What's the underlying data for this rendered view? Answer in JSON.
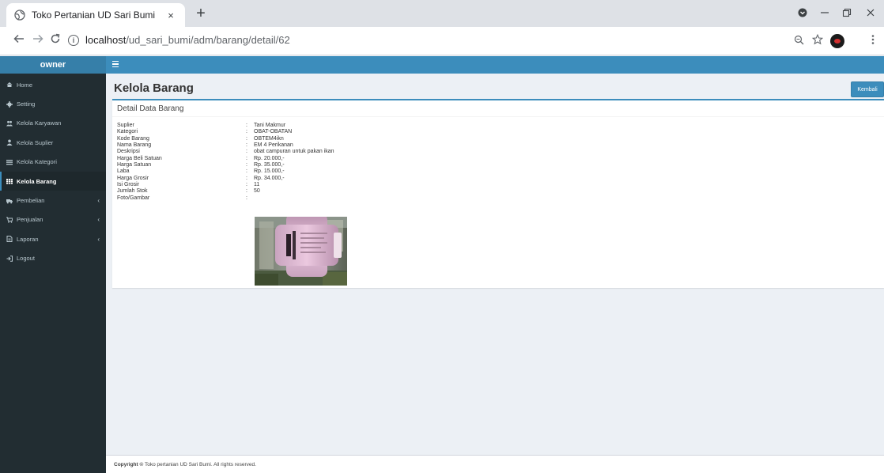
{
  "browser": {
    "tab_title": "Toko Pertanian UD Sari Bumi",
    "tab_close": "×",
    "new_tab": "+",
    "url_host": "localhost",
    "url_path": "/ud_sari_bumi/adm/barang/detail/62"
  },
  "sidebar": {
    "brand": "owner",
    "items": [
      {
        "label": "Home",
        "icon": "home-icon"
      },
      {
        "label": "Setting",
        "icon": "gear-icon"
      },
      {
        "label": "Kelola Karyawan",
        "icon": "users-icon"
      },
      {
        "label": "Kelola Suplier",
        "icon": "user-icon"
      },
      {
        "label": "Kelola Kategori",
        "icon": "list-icon"
      },
      {
        "label": "Kelola Barang",
        "icon": "table-icon",
        "active": true
      },
      {
        "label": "Pembelian",
        "icon": "truck-icon",
        "has_submenu": true
      },
      {
        "label": "Penjualan",
        "icon": "cart-icon",
        "has_submenu": true
      },
      {
        "label": "Laporan",
        "icon": "file-icon",
        "has_submenu": true
      },
      {
        "label": "Logout",
        "icon": "logout-icon"
      }
    ]
  },
  "page": {
    "title": "Kelola Barang",
    "back_button": "Kembali",
    "box_title": "Detail Data Barang",
    "details": [
      {
        "label": "Suplier",
        "value": "Tani Makmur"
      },
      {
        "label": "Kategori",
        "value": "OBAT-OBATAN"
      },
      {
        "label": "Kode Barang",
        "value": "OBTEM4ikn"
      },
      {
        "label": "Nama Barang",
        "value": "EM 4 Perikanan"
      },
      {
        "label": "Deskripsi",
        "value": "obat campuran untuk pakan ikan"
      },
      {
        "label": "Harga Beli Satuan",
        "value": "Rp. 20.000,-"
      },
      {
        "label": "Harga Satuan",
        "value": "Rp. 35.000,-"
      },
      {
        "label": "Laba",
        "value": "Rp. 15.000,-"
      },
      {
        "label": "Harga Grosir",
        "value": "Rp. 34.000,-"
      },
      {
        "label": "Isi Grosir",
        "value": "11"
      },
      {
        "label": "Jumlah Stok",
        "value": "50"
      },
      {
        "label": "Foto/Gambar",
        "value": ""
      }
    ],
    "colon": ":"
  },
  "footer": {
    "copyright_bold": "Copyright ©",
    "copyright_text": "Toko pertanian UD Sari Bumi.",
    "rights": "All rights reserved."
  },
  "colors": {
    "header": "#3c8dbc",
    "sidebar": "#222d32",
    "brand": "#367fa9"
  }
}
